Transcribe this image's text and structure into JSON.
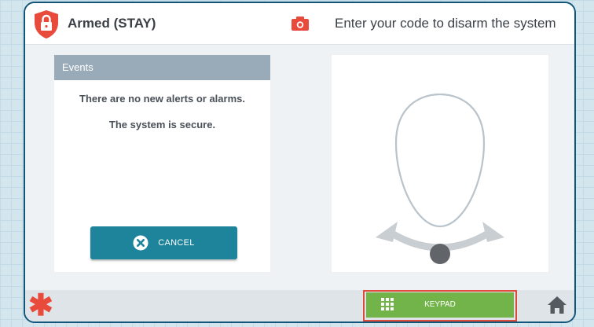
{
  "header": {
    "status_label": "Armed (STAY)",
    "status_icon": "shield-lock-icon",
    "camera_icon": "camera-icon",
    "prompt": "Enter your code to disarm the system"
  },
  "events": {
    "title": "Events",
    "line1": "There are no new alerts or alarms.",
    "line2": "The system is secure.",
    "cancel_label": "CANCEL"
  },
  "gesture": {
    "icon": "swipe-gesture-icon"
  },
  "footer": {
    "emergency_icon": "asterisk-icon",
    "keypad_label": "KEYPAD",
    "keypad_icon": "keypad-grid-icon",
    "home_icon": "home-icon"
  },
  "colors": {
    "frame": "#12557a",
    "alert_red": "#e84a3c",
    "cancel_teal": "#1e849c",
    "keypad_green": "#72b34a",
    "events_header": "#99abb8"
  }
}
